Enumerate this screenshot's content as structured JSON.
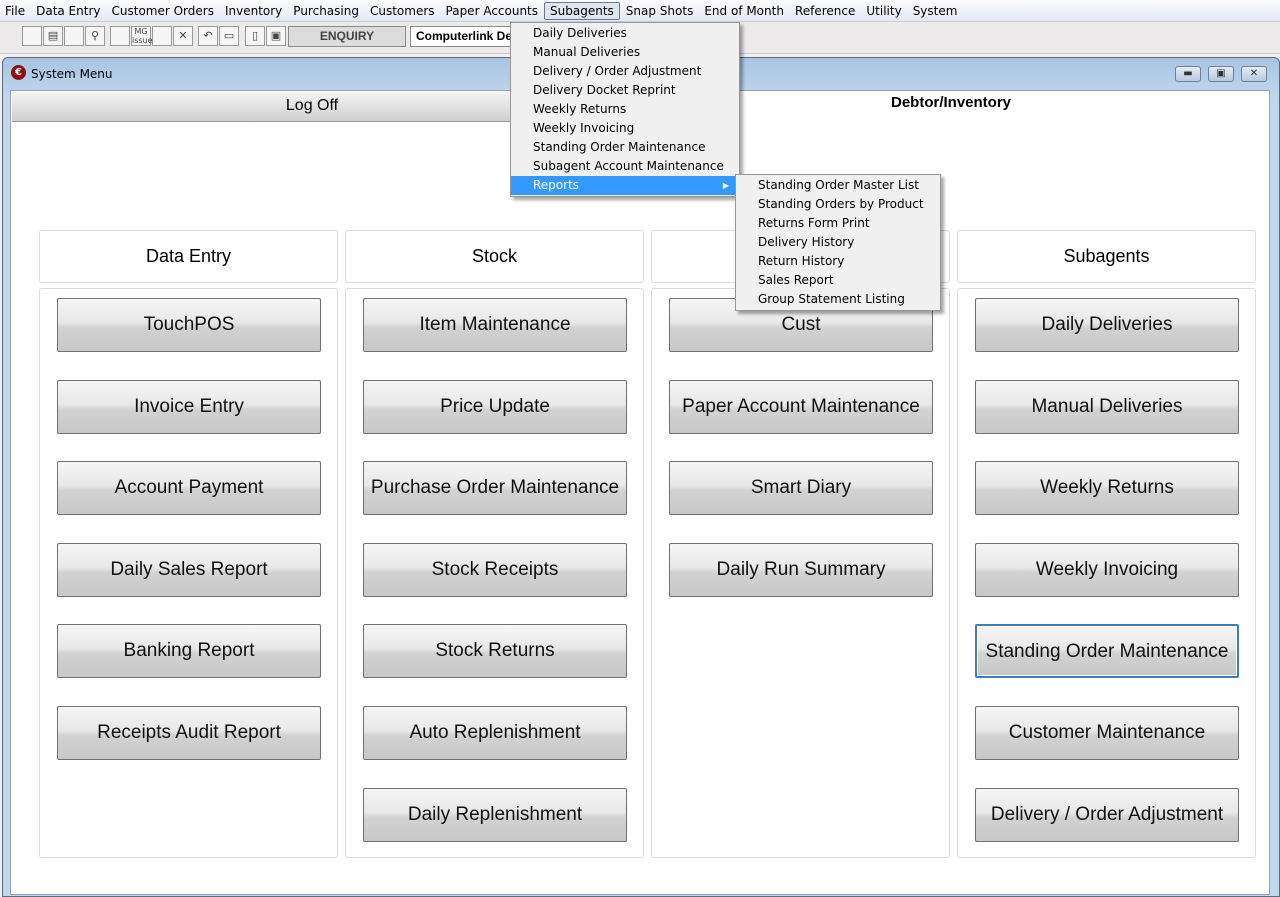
{
  "menubar": [
    "File",
    "Data Entry",
    "Customer Orders",
    "Inventory",
    "Purchasing",
    "Customers",
    "Paper Accounts",
    "Subagents",
    "Snap Shots",
    "End of Month",
    "Reference",
    "Utility",
    "System"
  ],
  "toolbar": {
    "mg_label": "MG",
    "issue_label": "issue",
    "mode": "ENQUIRY",
    "company": "Computerlink De"
  },
  "window": {
    "title": "System Menu",
    "log_off": "Log Off",
    "section_title": "Debtor/Inventory"
  },
  "columns": [
    {
      "header": "Data Entry",
      "buttons": [
        "TouchPOS",
        "Invoice Entry",
        "Account Payment",
        "Daily Sales Report",
        "Banking Report",
        "Receipts Audit Report"
      ]
    },
    {
      "header": "Stock",
      "buttons": [
        "Item Maintenance",
        "Price Update",
        "Purchase Order Maintenance",
        "Stock Receipts",
        "Stock Returns",
        "Auto Replenishment",
        "Daily Replenishment"
      ]
    },
    {
      "header": "",
      "buttons": [
        "Cust",
        "Paper Account Maintenance",
        "Smart Diary",
        "Daily Run Summary"
      ]
    },
    {
      "header": "Subagents",
      "buttons": [
        "Daily Deliveries",
        "Manual Deliveries",
        "Weekly Returns",
        "Weekly Invoicing",
        "Standing Order Maintenance",
        "Customer Maintenance",
        "Delivery / Order Adjustment"
      ],
      "focused": "Standing Order Maintenance"
    }
  ],
  "subagents_menu": [
    "Daily Deliveries",
    "Manual Deliveries",
    "Delivery / Order Adjustment",
    "Delivery Docket Reprint",
    "Weekly Returns",
    "Weekly Invoicing",
    "Standing Order Maintenance",
    "Subagent Account Maintenance",
    "Reports"
  ],
  "reports_menu": [
    "Standing Order Master List",
    "Standing Orders by Product",
    "Returns Form Print",
    "Delivery History",
    "Return History",
    "Sales Report",
    "Group Statement Listing"
  ],
  "colors": {
    "highlight": "#3399ff",
    "focus_border": "#3c7fb1"
  }
}
